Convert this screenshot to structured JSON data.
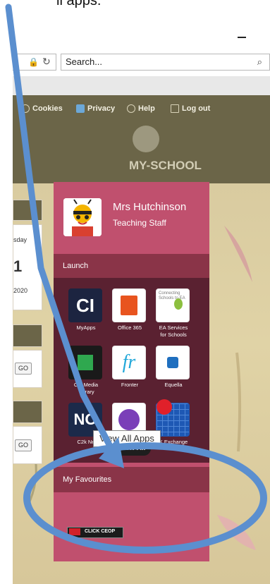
{
  "caption_text": "ll apps.",
  "browser": {
    "search_placeholder": "Search...",
    "search_icon": "search-icon",
    "minimize_icon": "minimize-icon"
  },
  "nav": {
    "items": [
      {
        "label": "Cookies",
        "icon": "cookie-icon"
      },
      {
        "label": "Privacy",
        "icon": "privacy-icon"
      },
      {
        "label": "Help",
        "icon": "help-icon"
      },
      {
        "label": "Log out",
        "icon": "logout-icon"
      }
    ]
  },
  "brand": {
    "logo_text": "MY-SCHOOL"
  },
  "left_cards": {
    "day_fragment": "sday",
    "date_number": "1",
    "year_fragment": "2020",
    "go_label_1": "GO",
    "go_label_2": "GO"
  },
  "user": {
    "name": "Mrs Hutchinson",
    "role": "Teaching Staff"
  },
  "launch": {
    "heading": "Launch",
    "apps": [
      {
        "label": "MyApps",
        "icon": "myapps-icon"
      },
      {
        "label": "Office 365",
        "icon": "office365-icon"
      },
      {
        "label": "EA Services for Schools",
        "icon": "ea-services-icon",
        "icon_text": "Connecting Schools to EA"
      },
      {
        "label": "C2k Media Library",
        "visible_label": "C    Media\n     rary",
        "icon": "media-library-icon"
      },
      {
        "label": "Fronter",
        "icon": "fronter-icon"
      },
      {
        "label": "Equella",
        "icon": "equella-icon"
      },
      {
        "label": "C2k Ne",
        "icon": "c2k-ne-icon"
      },
      {
        "label": "",
        "icon": "tools-icon"
      },
      {
        "label": "K Exchange",
        "icon": "exchange-icon"
      }
    ],
    "tooltip": "View All Apps",
    "view_all_label": "View All"
  },
  "favourites": {
    "heading": "My Favourites",
    "ceop_label": "CLICK CEOP"
  },
  "colors": {
    "header": "#6b6548",
    "panel": "#c0506e",
    "panel_dark": "#8a3448",
    "apps_bg": "#5a2131",
    "annotation_blue": "#5b8fcf"
  }
}
